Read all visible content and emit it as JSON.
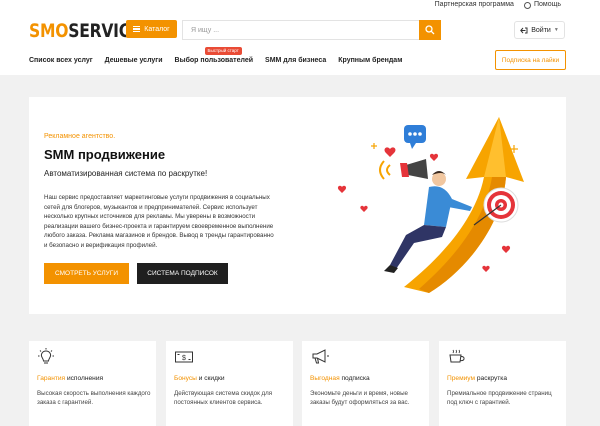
{
  "topbar": {
    "partner_label": "Партнерская программа",
    "help_label": "Помощь"
  },
  "header": {
    "logo_part1": "SMO",
    "logo_part2": "SERVICE",
    "catalog_label": "Каталог",
    "search_placeholder": "Я ищу ...",
    "login_label": "Войти"
  },
  "nav": {
    "items": [
      {
        "label": "Список всех услуг"
      },
      {
        "label": "Дешевые услуги"
      },
      {
        "label": "Выбор пользователей"
      },
      {
        "label": "SMM для бизнеса"
      },
      {
        "label": "Крупным брендам"
      }
    ],
    "badge_label": "Быстрый старт",
    "subscribe_label": "Подписка на лайки"
  },
  "hero": {
    "subtitle": "Рекламное агентство.",
    "title": "SMM продвижение",
    "lead": "Автоматизированная система по раскрутке!",
    "description": "Наш сервис предоставляет маркетинговые услуги продвижения в социальных сетей для блогеров, музыкантов и предпринимателей. Сервис использует несколько крупных источников для рекламы. Мы уверены в возможности реализации вашего бизнес-проекта и гарантируем своевременное выполнение любого заказа. Реклама магазинов и брендов. Вывод в тренды гарантированно и безопасно и верификация профилей.",
    "primary_button": "СМОТРЕТЬ УСЛУГИ",
    "secondary_button": "СИСТЕМА ПОДПИСОК"
  },
  "features": [
    {
      "icon": "lightbulb-icon",
      "title_highlight": "Гарантия",
      "title_rest": " исполнения",
      "text": "Высокая скорость выполнения каждого заказа с гарантией."
    },
    {
      "icon": "money-icon",
      "title_highlight": "Бонусы",
      "title_rest": " и скидки",
      "text": "Действующая система скидок для постоянных клиентов сервиса."
    },
    {
      "icon": "megaphone-icon",
      "title_highlight": "Выгодная",
      "title_rest": " подписка",
      "text": "Экономьте деньги и время, новые заказы будут оформляться за вас."
    },
    {
      "icon": "coffee-icon",
      "title_highlight": "Премиум",
      "title_rest": " раскрутка",
      "text": "Премиальное продвижение страниц под ключ с гарантией."
    }
  ],
  "colors": {
    "accent": "#f39200",
    "dark": "#1f1f1f",
    "badge": "#e94b35",
    "background": "#f1f1f1"
  }
}
